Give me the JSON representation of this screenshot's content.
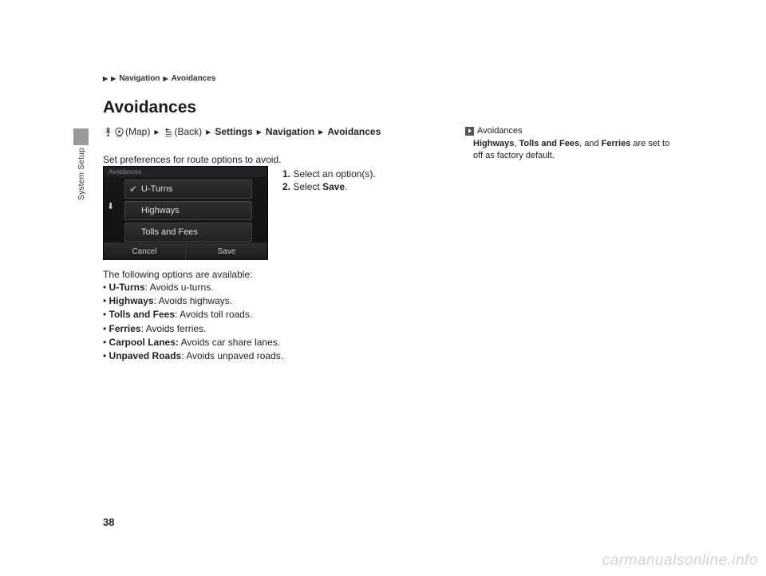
{
  "breadcrumb": {
    "items": [
      "Navigation",
      "Avoidances"
    ]
  },
  "title": "Avoidances",
  "section": "System Setup",
  "navpath": {
    "mapLabel": " (Map) ",
    "backLabel": " (Back) ",
    "items": [
      "Settings",
      "Navigation",
      "Avoidances"
    ]
  },
  "intro": "Set preferences for route options to avoid.",
  "screenshot": {
    "header": "Avoidances",
    "options": [
      "U-Turns",
      "Highways",
      "Tolls and Fees"
    ],
    "buttons": [
      "Cancel",
      "Save"
    ]
  },
  "steps": [
    {
      "num": "1.",
      "text": "Select an option(s)."
    },
    {
      "num": "2.",
      "prefix": "Select",
      "bold": "Save",
      "suffix": "."
    }
  ],
  "optionsIntro": "The following options are available:",
  "options": [
    {
      "name": "U-Turns",
      "desc": ": Avoids u-turns."
    },
    {
      "name": "Highways",
      "desc": ": Avoids highways."
    },
    {
      "name": "Tolls and Fees",
      "desc": ": Avoids toll roads."
    },
    {
      "name": "Ferries",
      "desc": ": Avoids ferries."
    },
    {
      "name": "Carpool Lanes:",
      "desc": " Avoids car share lanes."
    },
    {
      "name": "Unpaved Roads",
      "desc": ": Avoids unpaved roads."
    }
  ],
  "note": {
    "title": "Avoidances",
    "bold": [
      "Highways",
      "Tolls and Fees",
      "Ferries"
    ],
    "plain": [
      ", ",
      ", and ",
      " are set to off as factory default."
    ]
  },
  "pageNumber": "38",
  "watermark": "carmanualsonline.info"
}
